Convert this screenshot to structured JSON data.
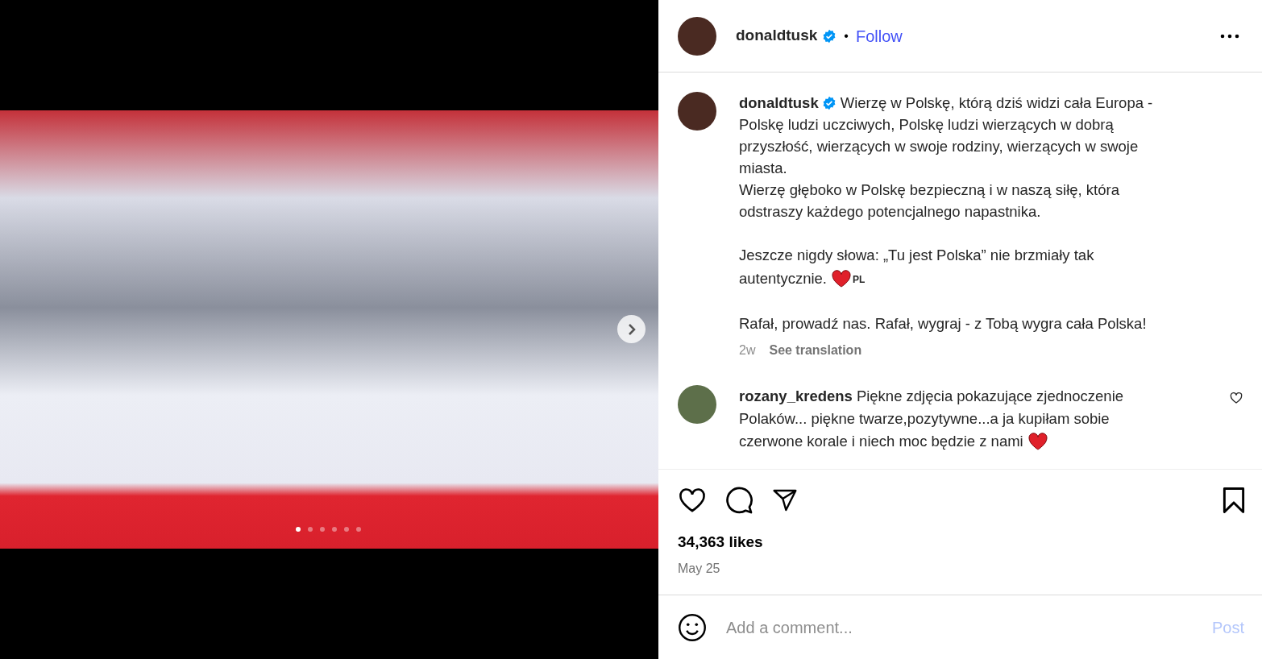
{
  "media": {
    "dots": [
      {
        "selected": true
      },
      {
        "selected": false
      },
      {
        "selected": false
      },
      {
        "selected": false
      },
      {
        "selected": false
      },
      {
        "selected": false
      }
    ]
  },
  "header": {
    "username": "donaldtusk",
    "verified": true,
    "separator": "•",
    "follow": "Follow"
  },
  "caption": {
    "username": "donaldtusk",
    "verified": true,
    "paragraphs": [
      {
        "lines": [
          "Wierzę w Polskę, którą dziś widzi cała Europa -",
          "Polskę ludzi uczciwych, Polskę ludzi wierzących w dobrą",
          "przyszłość, wierzących w swoje rodziny, wierzących w swoje",
          "miasta.",
          "Wierzę głęboko w Polskę bezpieczną i w naszą siłę, która",
          "odstraszy każdego potencjalnego napastnika."
        ],
        "heart": false
      },
      {
        "lines": [
          "Jeszcze nigdy słowa: „Tu jest Polska” nie brzmiały tak",
          "autentycznie."
        ],
        "heart": true,
        "flag": "PL"
      },
      {
        "lines": [
          "Rafał, prowadź nas. Rafał, wygraj - z Tobą wygra cała Polska!"
        ],
        "heart": false
      }
    ],
    "time": "2w",
    "translate": "See translation"
  },
  "comments": [
    {
      "username": "rozany_kredens",
      "lines": [
        "Piękne zdjęcia pokazujące zjednoczenie",
        "Polaków... piękne twarze,pozytywne...a ja kupiłam sobie",
        "czerwone korale i niech moc będzie z nami"
      ],
      "heart": true,
      "liked": false
    }
  ],
  "likes": "34,363 likes",
  "date": "May 25",
  "comment_box": {
    "placeholder": "Add a comment...",
    "post": "Post"
  }
}
